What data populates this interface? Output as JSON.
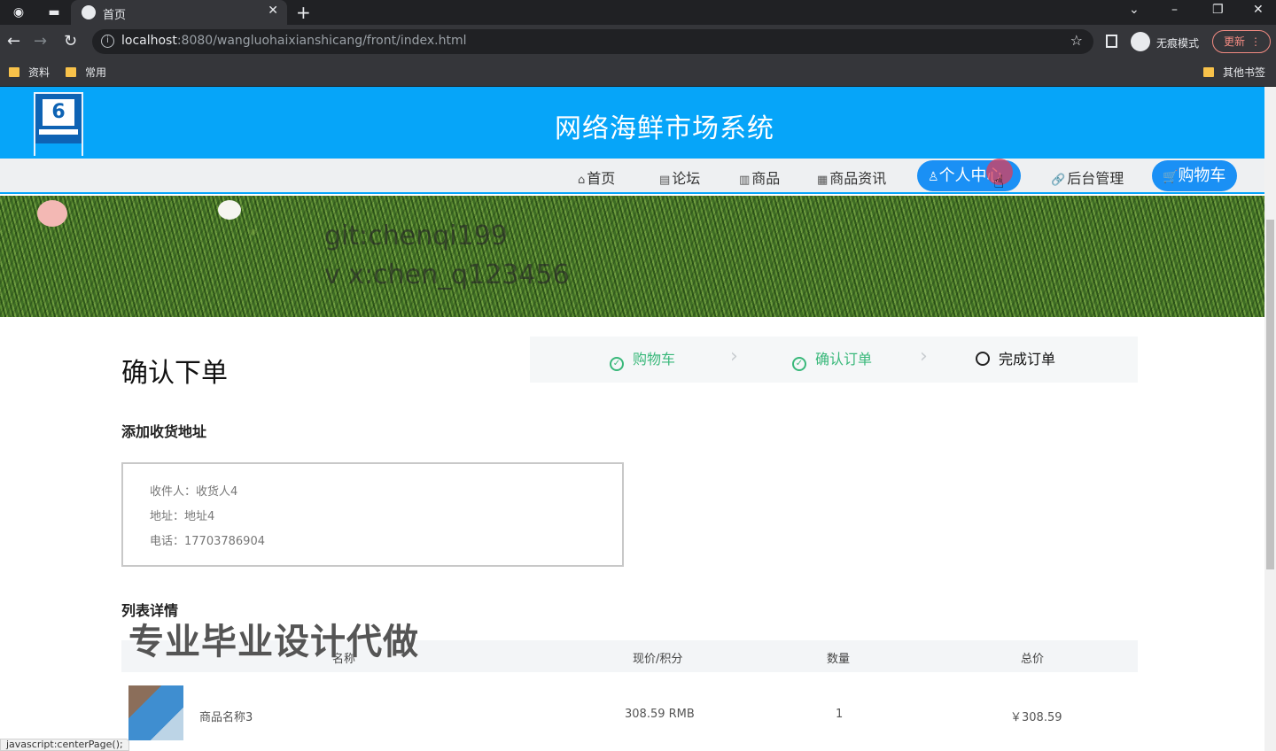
{
  "browser": {
    "tab_title": "首页",
    "url_host": "localhost",
    "url_rest": ":8080/wangluohaixianshicang/front/index.html",
    "incognito_label": "无痕模式",
    "update_label": "更新",
    "bookmarks": [
      "资料",
      "常用"
    ],
    "other_bookmarks": "其他书签",
    "status_text": "javascript:centerPage();"
  },
  "site": {
    "title": "网络海鲜市场系统",
    "nav": [
      {
        "label": "首页",
        "icon": "home-icon"
      },
      {
        "label": "论坛",
        "icon": "forum-icon"
      },
      {
        "label": "商品",
        "icon": "gift-icon"
      },
      {
        "label": "商品资讯",
        "icon": "news-icon"
      },
      {
        "label": "个人中心",
        "icon": "user-icon"
      },
      {
        "label": "后台管理",
        "icon": "link-icon"
      },
      {
        "label": "购物车",
        "icon": "cart-icon"
      }
    ]
  },
  "banner": {
    "line1": "git:chenqi199",
    "line2": "v x:chen_q123456"
  },
  "order": {
    "heading": "确认下单",
    "steps": [
      {
        "label": "购物车",
        "state": "done"
      },
      {
        "label": "确认订单",
        "state": "done"
      },
      {
        "label": "完成订单",
        "state": "current"
      }
    ],
    "address_section": "添加收货地址",
    "address": {
      "receiver": "收件人：收货人4",
      "address": "地址：地址4",
      "phone": "电话：17703786904"
    },
    "list_section": "列表详情",
    "promo_overlay": "专业毕业设计代做",
    "columns": [
      "名称",
      "现价/积分",
      "数量",
      "总价"
    ],
    "rows": [
      {
        "name": "商品名称3",
        "price": "308.59 RMB",
        "qty": "1",
        "total": "￥308.59"
      }
    ]
  },
  "colors": {
    "header_blue": "#06a5f9",
    "pill_blue": "#1a90f5",
    "step_green": "#39b87a"
  }
}
